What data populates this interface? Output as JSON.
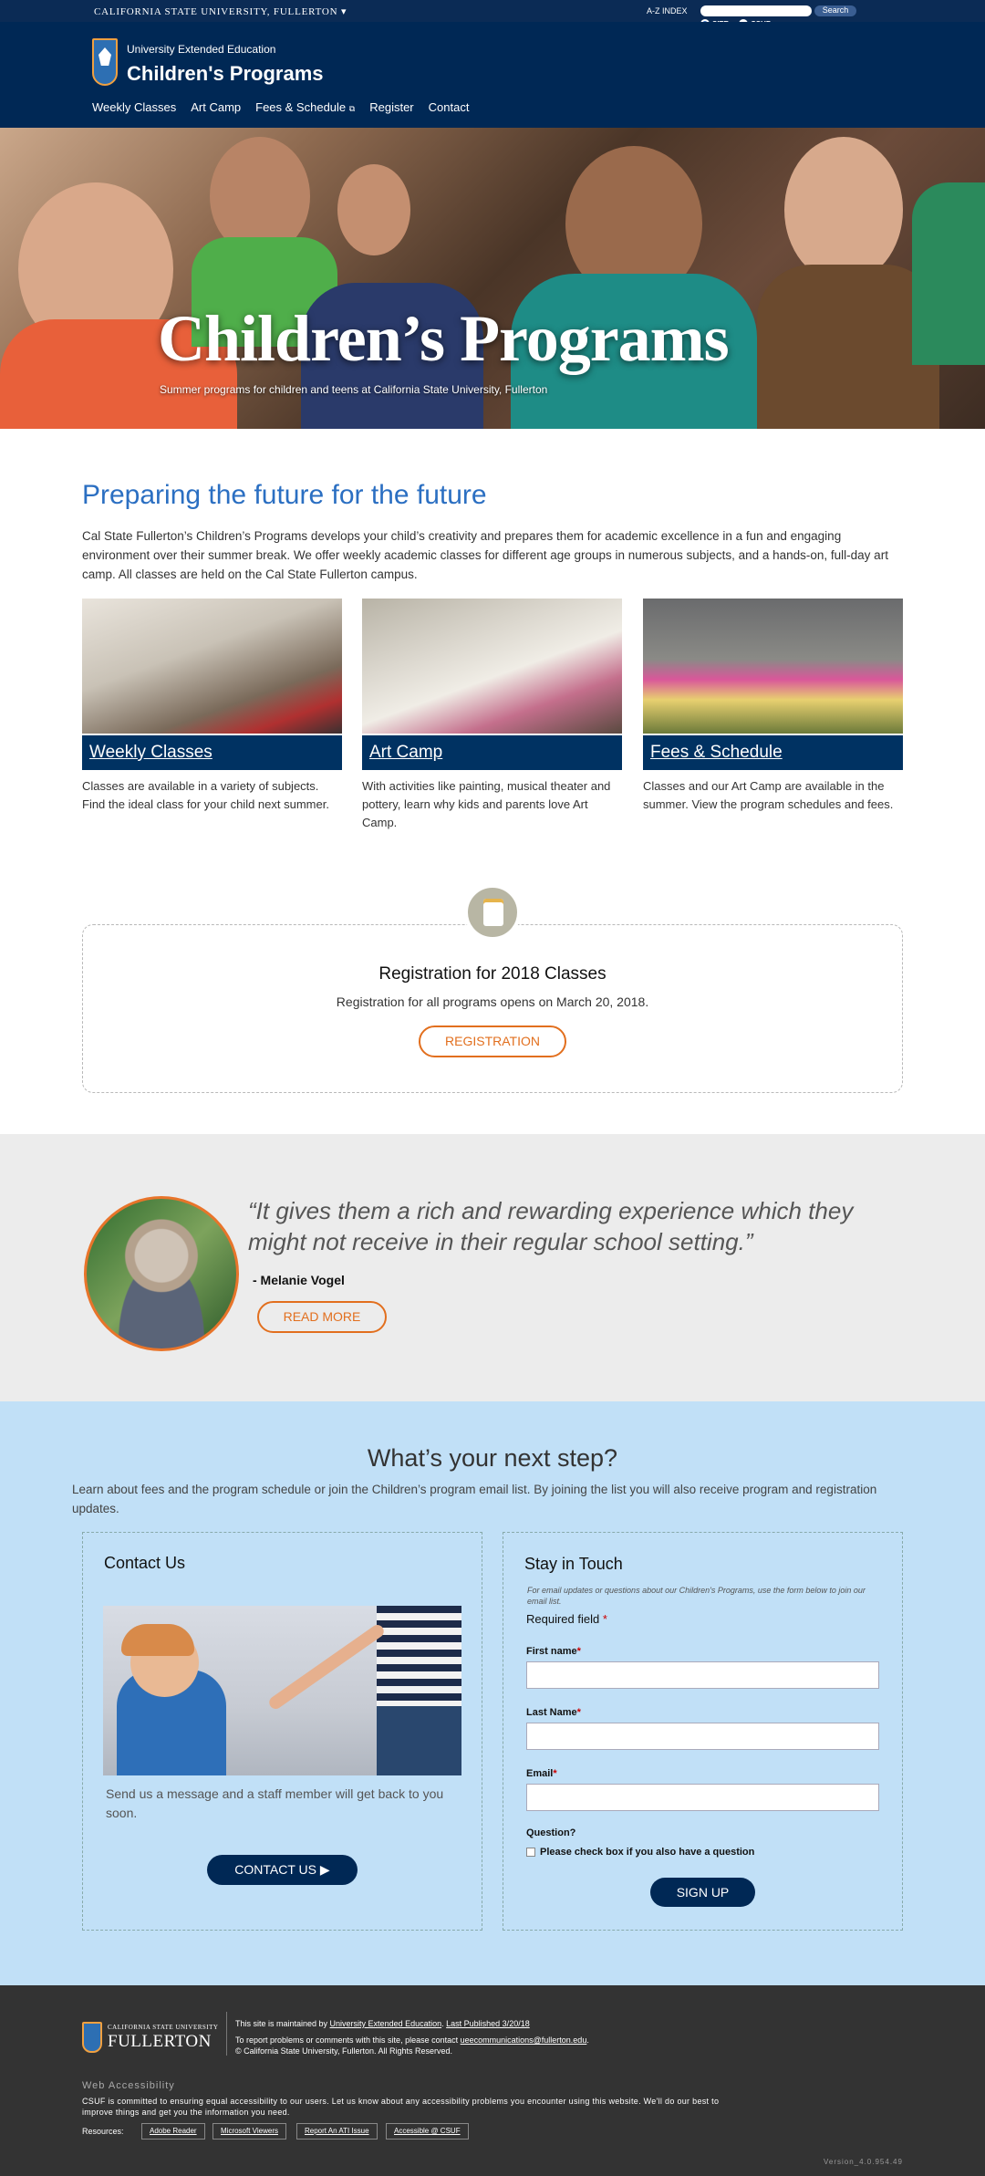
{
  "topbar": {
    "university": "CALIFORNIA STATE UNIVERSITY, FULLERTON",
    "az_index": "A-Z INDEX",
    "search_button": "Search",
    "scope_site": "SITE",
    "scope_csuf": "CSUF"
  },
  "header": {
    "department": "University Extended Education",
    "title": "Children's Programs",
    "logo_text": "CSUF"
  },
  "nav": [
    "Weekly Classes",
    "Art Camp",
    "Fees & Schedule",
    "Register",
    "Contact"
  ],
  "hero": {
    "title": "Children’s Programs",
    "subtitle": "Summer programs for children and teens at California State University, Fullerton"
  },
  "intro": {
    "heading": "Preparing the future for the future",
    "text": "Cal State Fullerton’s Children’s Programs develops your child’s creativity and prepares them for academic excellence in a fun and engaging environment over their summer break. We offer weekly academic classes for different age groups in numerous subjects, and a hands-on, full-day art camp. All classes are held on the Cal State Fullerton campus."
  },
  "cards": [
    {
      "title": "Weekly Classes",
      "text": "Classes are available in a variety of subjects. Find the ideal class for your child next summer."
    },
    {
      "title": "Art Camp",
      "text": "With activities like painting, musical theater and pottery, learn why kids and parents love Art Camp."
    },
    {
      "title": "Fees & Schedule",
      "text": "Classes and our Art Camp are available in the summer. View the program schedules and fees."
    }
  ],
  "registration": {
    "title": "Registration for 2018 Classes",
    "text": "Registration for all programs opens on March 20, 2018.",
    "button": "REGISTRATION"
  },
  "testimonial": {
    "quote": "“It gives them a rich and rewarding experience which they might not receive in their regular school setting.”",
    "author": "- Melanie Vogel",
    "button": "READ MORE"
  },
  "next_step": {
    "heading": "What’s your next step?",
    "text": "Learn about fees and the program schedule or join the Children’s program email list. By joining the list you will also receive program and registration updates."
  },
  "contact": {
    "title": "Contact Us",
    "text": "Send us a message and a staff member will get back to you soon.",
    "button": "CONTACT US"
  },
  "stay": {
    "title": "Stay in Touch",
    "note": "For email updates or questions about our Children's Programs, use the form below to join our email list.",
    "required": "Required field",
    "first_name": "First name",
    "last_name": "Last Name",
    "email": "Email",
    "question": "Question?",
    "checkbox": "Please check box if you also have a question",
    "button": "SIGN UP"
  },
  "footer": {
    "csuf_small": "CALIFORNIA STATE UNIVERSITY",
    "csuf_big": "FULLERTON",
    "maintained_prefix": "This site is maintained by ",
    "maintained_link": "University Extended Education",
    "published": "Last Published 3/20/18",
    "report_prefix": "To report problems or comments with this site, please contact ",
    "report_email": "ueecommunications@fullerton.edu",
    "copyright": "© California State University, Fullerton. All Rights Reserved.",
    "wa_title": "Web Accessibility",
    "wa_text": "CSUF is committed to ensuring equal accessibility to our users. Let us know about any accessibility problems you encounter using this website. We'll do our best to improve things and get you the information you need.",
    "resources_label": "Resources:",
    "resources": [
      "Adobe Reader",
      "Microsoft Viewers",
      "Report An ATI Issue",
      "Accessible @ CSUF"
    ],
    "version": "Version_4.0.954.49"
  }
}
